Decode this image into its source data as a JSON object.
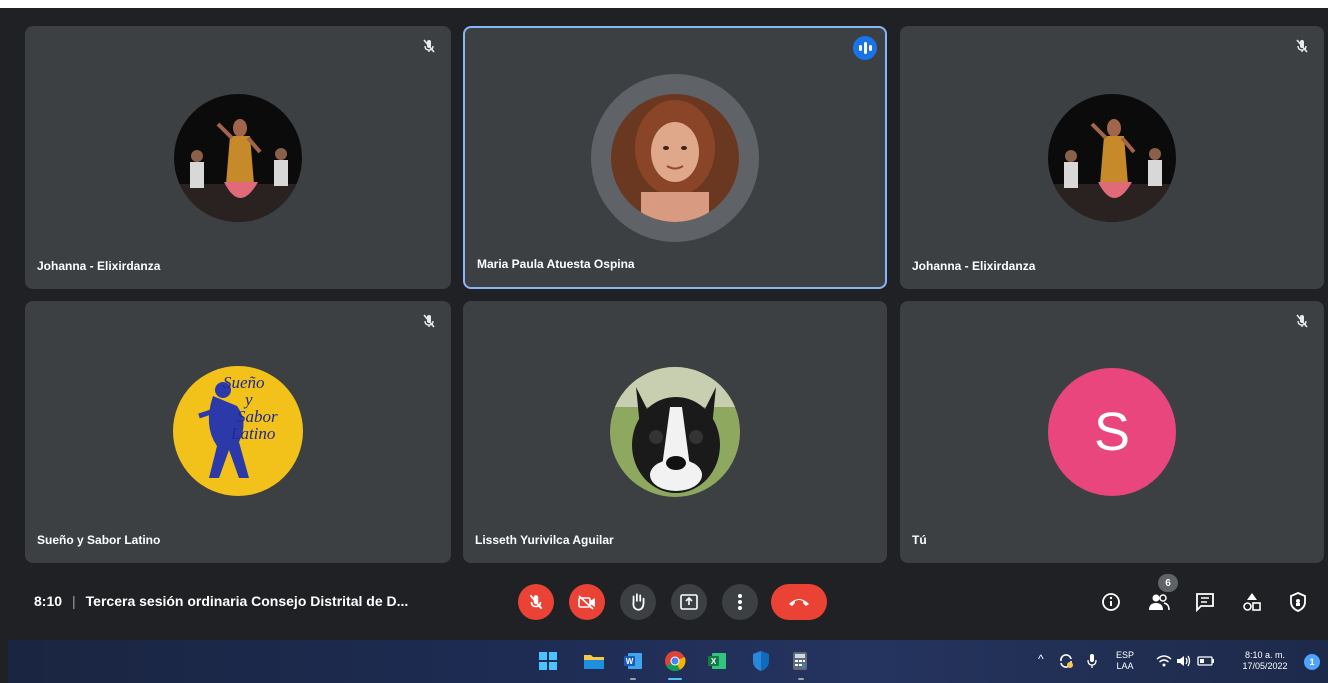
{
  "tiles": [
    {
      "name": "Johanna - Elixirdanza",
      "muted": true,
      "avatar": "dancer-photo"
    },
    {
      "name": "Maria Paula Atuesta Ospina",
      "muted": false,
      "speaking": true,
      "avatar": "woman-photo"
    },
    {
      "name": "Johanna - Elixirdanza",
      "muted": true,
      "avatar": "dancer-photo"
    },
    {
      "name": "Sueño y Sabor Latino",
      "muted": true,
      "avatar": "logo",
      "logo_lines": [
        "Sueño",
        "y",
        "Sabor",
        "Latino"
      ]
    },
    {
      "name": "Lisseth Yurivilca Aguilar",
      "muted": false,
      "avatar": "dog-photo"
    },
    {
      "name": "Tú",
      "muted": true,
      "avatar": "initial",
      "initial": "S",
      "initial_color": "#e8467c"
    }
  ],
  "meeting": {
    "time": "8:10",
    "title": "Tercera sesión ordinaria Consejo Distrital de D..."
  },
  "controls": [
    "mic-off-icon",
    "camera-off-icon",
    "raise-hand-icon",
    "present-icon",
    "more-options-icon",
    "end-call-icon"
  ],
  "right_controls": [
    "info-icon",
    "people-icon",
    "chat-icon",
    "activities-icon",
    "host-controls-icon"
  ],
  "people_count": "6",
  "taskbar": {
    "apps": [
      "windows-start-icon",
      "file-explorer-icon",
      "word-icon",
      "chrome-icon",
      "excel-icon",
      "defender-icon",
      "calculator-icon"
    ],
    "lang_top": "ESP",
    "lang_bottom": "LAA",
    "clock_time": "8:10 a. m.",
    "clock_date": "17/05/2022",
    "notifications": "1"
  },
  "colors": {
    "tile_bg": "#3c4043",
    "accent": "#8ab4f8",
    "red": "#ea4335",
    "speaking_blue": "#1a73e8"
  }
}
